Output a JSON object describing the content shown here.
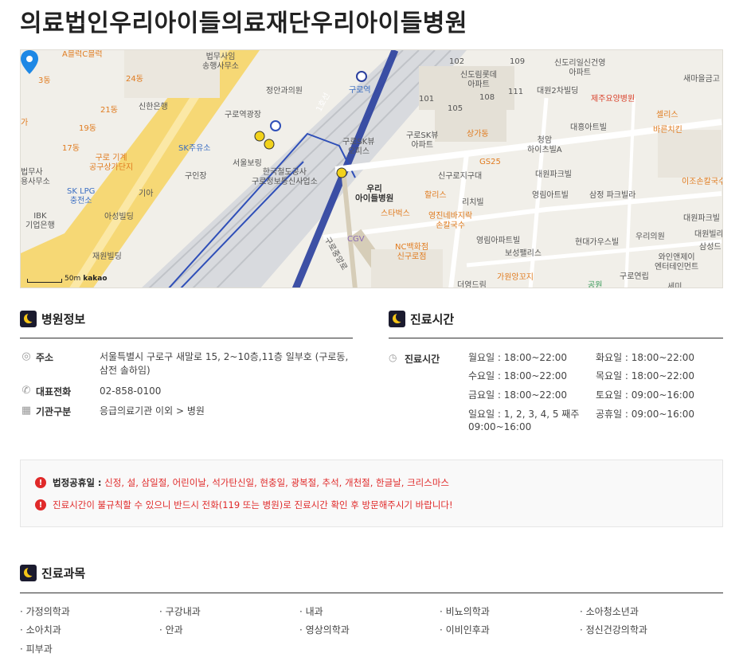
{
  "page_title": "의료법인우리아이들의료재단우리아이들병원",
  "map": {
    "scale_label": "50m",
    "provider": "kakao",
    "labels": {
      "a_block": "A블럭C블럭",
      "dong3": "3동",
      "dong24": "24동",
      "dong21": "21동",
      "dong19": "19동",
      "dong17": "17동",
      "ga": "가",
      "beopmu_top": "법무사임\n송행사무소",
      "shinhan": "신한은행",
      "jeongan": "정안과의원",
      "guro_plaza": "구로역광장",
      "sk_gas": "SK주유소",
      "guro_machine": "구로 기계\n공구상가단지",
      "beopmu_left": "법무사\n용사무소",
      "sk_lpg": "SK LPG\n충전소",
      "ibk": "IBK\n기업은행",
      "guinjang": "구인장",
      "kia": "기아",
      "seoul_boring": "서울보링",
      "asung": "아성빌딩",
      "jaewon": "재원빌딩",
      "station_kr": "구로역",
      "line1": "1호선",
      "korail": "한국철도공사\n구로정보통신사업소",
      "skview": "구로SK뷰\n아파트",
      "skview_office": "구로SK뷰\n오피스",
      "woori": "우리\n아이들병원",
      "cgv": "CGV",
      "starbucks": "스타벅스",
      "hollys": "할리스",
      "genesis_c": "영진네바지락\n손칼국수",
      "nc_dept": "NC백화점\n신구로점",
      "guro_road": "구로중앙로",
      "sangga": "상가동",
      "gs25": "GS25",
      "singuro_jigu": "신구로지구대",
      "richi": "리치빌",
      "apt102": "102",
      "apt109": "109",
      "apt101": "101",
      "apt105": "105",
      "apt108": "108",
      "apt111": "111",
      "sindorim_lotte": "신도림롯데\n아파트",
      "sindorim_il": "신도리일신건영\n아파트",
      "daewon2": "대원2차빌딩",
      "jeju": "제주요양병원",
      "semaeul": "새마을금고",
      "sellis": "셀리스",
      "barun": "바른치킨",
      "daeheung": "대흥아트빌",
      "cheongam": "청암\n하이츠빌A",
      "daewon_park": "대원파크빌",
      "yeongrim_art": "영림아트빌",
      "samjeong": "삼정 파크빌라",
      "ijo": "이조손칼국수",
      "daewon_park2": "대원파크빌",
      "daewon_villa": "대원빌라",
      "samseong": "삼성드",
      "yeongrim_apt": "영림아파트빌",
      "hyundai": "현대가우스빌",
      "woori_clinic": "우리의원",
      "boseong": "보성팰리스",
      "wine": "와인앤제이\n엔터테인먼트",
      "guro_yeonrip": "구로연립",
      "gawon": "가원앙꼬지",
      "deokyoung": "더영드림",
      "park": "공원",
      "saeil": "세미"
    }
  },
  "hospital_info": {
    "heading": "병원정보",
    "rows": [
      {
        "icon": "location-icon",
        "label": "주소",
        "value": "서울특별시 구로구 새말로 15, 2~10층,11층 일부호 (구로동, 삼전 솔하임)"
      },
      {
        "icon": "phone-icon",
        "label": "대표전화",
        "value": "02-858-0100"
      },
      {
        "icon": "building-icon",
        "label": "기관구분",
        "value": "응급의료기관 이외 > 병원"
      }
    ]
  },
  "hours": {
    "heading": "진료시간",
    "label": "진료시간",
    "items": [
      "월요일 :  18:00~22:00",
      "화요일 :  18:00~22:00",
      "수요일 :  18:00~22:00",
      "목요일 :  18:00~22:00",
      "금요일 :  18:00~22:00",
      "토요일 :  09:00~16:00",
      "일요일 :   1, 2, 3, 4, 5 째주",
      "09:00~16:00",
      "공휴일 :  09:00~16:00"
    ]
  },
  "notice": {
    "holiday_label": "법정공휴일 :",
    "holiday_text": "신정, 설, 삼일절, 어린이날, 석가탄신일, 현충일, 광복절, 추석, 개천절, 한글날, 크리스마스",
    "warning": "진료시간이 불규칙할 수 있으니 반드시 전화(119 또는 병원)로 진료시간 확인 후 방문해주시기 바랍니다!"
  },
  "departments": {
    "heading": "진료과목",
    "items": [
      "가정의학과",
      "구강내과",
      "내과",
      "비뇨의학과",
      "소아청소년과",
      "소아치과",
      "안과",
      "영상의학과",
      "이비인후과",
      "정신건강의학과",
      "피부과"
    ]
  },
  "colors": {
    "accent_red": "#e02a2a",
    "map_orange": "#e07b1f",
    "map_blue": "#2f4fb8",
    "pin_blue": "#1e88e5"
  }
}
